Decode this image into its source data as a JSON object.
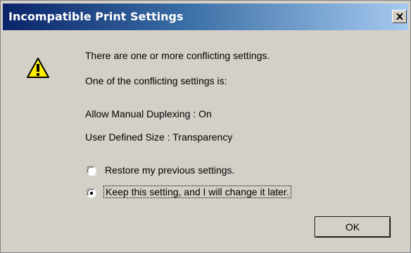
{
  "dialog": {
    "title": "Incompatible Print Settings",
    "close_label": "×",
    "icon": "warning-triangle-icon",
    "message_line_1": "There are one or more conflicting settings.",
    "message_line_2": "One of the conflicting settings is:",
    "conflict_1": "Allow Manual Duplexing : On",
    "conflict_2": "User Defined Size : Transparency",
    "options": [
      {
        "label": "Restore my previous settings.",
        "selected": false
      },
      {
        "label": "Keep this setting, and I will change it later.",
        "selected": true
      }
    ],
    "ok_label": "OK"
  },
  "colors": {
    "dialog_bg": "#d4d0c8",
    "titlebar_start": "#0a246a",
    "titlebar_end": "#a6caf0",
    "warning_yellow": "#ffee00"
  }
}
